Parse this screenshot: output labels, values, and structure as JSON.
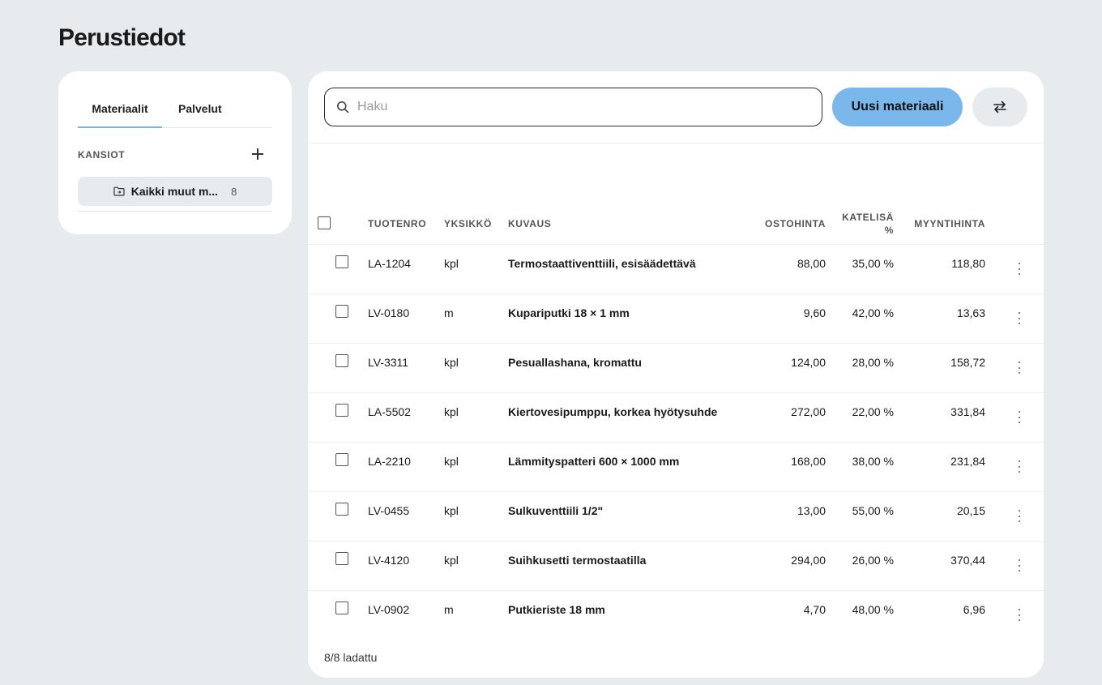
{
  "page": {
    "title": "Perustiedot"
  },
  "left": {
    "tabs": [
      {
        "label": "Materiaalit",
        "active": true
      },
      {
        "label": "Palvelut",
        "active": false
      }
    ],
    "folders_label": "KANSIOT",
    "folder": {
      "name": "Kaikki muut m...",
      "count": "8"
    }
  },
  "toolbar": {
    "search_placeholder": "Haku",
    "new_label": "Uusi materiaali"
  },
  "table": {
    "headers": {
      "tuotenro": "TUOTENRO",
      "yksikko": "YKSIKKÖ",
      "kuvaus": "KUVAUS",
      "ostohinta": "OSTOHINTA",
      "katelisa_1": "KATELISÄ",
      "katelisa_2": "%",
      "myyntihinta": "MYYNTIHINTA"
    },
    "rows": [
      {
        "tuotenro": "LA-1204",
        "yksikko": "kpl",
        "kuvaus": "Termostaattiventtiili, esisäädettävä",
        "ostohinta": "88,00",
        "katelisa": "35,00 %",
        "myyntihinta": "118,80"
      },
      {
        "tuotenro": "LV-0180",
        "yksikko": "m",
        "kuvaus": "Kupariputki 18 × 1 mm",
        "ostohinta": "9,60",
        "katelisa": "42,00 %",
        "myyntihinta": "13,63"
      },
      {
        "tuotenro": "LV-3311",
        "yksikko": "kpl",
        "kuvaus": "Pesuallashana, kromattu",
        "ostohinta": "124,00",
        "katelisa": "28,00 %",
        "myyntihinta": "158,72"
      },
      {
        "tuotenro": "LA-5502",
        "yksikko": "kpl",
        "kuvaus": "Kiertovesipumppu, korkea hyötysuhde",
        "ostohinta": "272,00",
        "katelisa": "22,00 %",
        "myyntihinta": "331,84"
      },
      {
        "tuotenro": "LA-2210",
        "yksikko": "kpl",
        "kuvaus": "Lämmityspatteri 600 × 1000 mm",
        "ostohinta": "168,00",
        "katelisa": "38,00 %",
        "myyntihinta": "231,84"
      },
      {
        "tuotenro": "LV-0455",
        "yksikko": "kpl",
        "kuvaus": "Sulkuventtiili 1/2\"",
        "ostohinta": "13,00",
        "katelisa": "55,00 %",
        "myyntihinta": "20,15"
      },
      {
        "tuotenro": "LV-4120",
        "yksikko": "kpl",
        "kuvaus": "Suihkusetti termostaatilla",
        "ostohinta": "294,00",
        "katelisa": "26,00 %",
        "myyntihinta": "370,44"
      },
      {
        "tuotenro": "LV-0902",
        "yksikko": "m",
        "kuvaus": "Putkieriste 18 mm",
        "ostohinta": "4,70",
        "katelisa": "48,00 %",
        "myyntihinta": "6,96"
      }
    ],
    "footer": "8/8 ladattu"
  },
  "icons": {
    "search": "search-icon",
    "add": "plus-icon",
    "folder": "folder-icon",
    "swap": "swap-arrows-icon",
    "more": "kebab-menu-icon"
  },
  "colors": {
    "background": "#e8ebee",
    "accent": "#7ab8ec",
    "tab_underline": "#74b3ea"
  }
}
